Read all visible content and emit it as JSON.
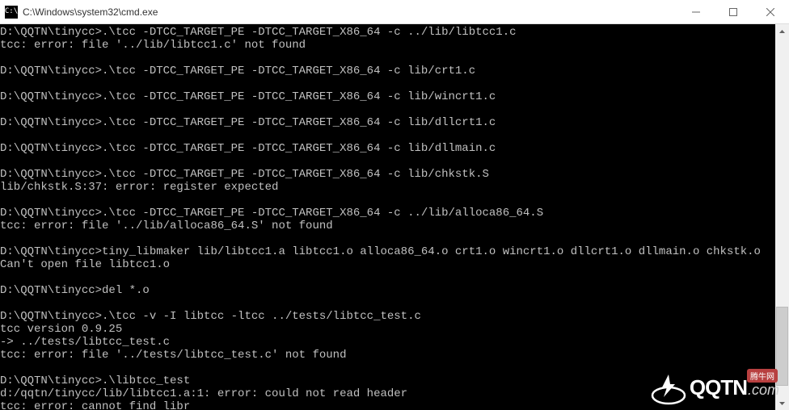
{
  "window": {
    "title": "C:\\Windows\\system32\\cmd.exe"
  },
  "terminal": {
    "lines": [
      "D:\\QQTN\\tinycc>.\\tcc -DTCC_TARGET_PE -DTCC_TARGET_X86_64 -c ../lib/libtcc1.c",
      "tcc: error: file '../lib/libtcc1.c' not found",
      "",
      "D:\\QQTN\\tinycc>.\\tcc -DTCC_TARGET_PE -DTCC_TARGET_X86_64 -c lib/crt1.c",
      "",
      "D:\\QQTN\\tinycc>.\\tcc -DTCC_TARGET_PE -DTCC_TARGET_X86_64 -c lib/wincrt1.c",
      "",
      "D:\\QQTN\\tinycc>.\\tcc -DTCC_TARGET_PE -DTCC_TARGET_X86_64 -c lib/dllcrt1.c",
      "",
      "D:\\QQTN\\tinycc>.\\tcc -DTCC_TARGET_PE -DTCC_TARGET_X86_64 -c lib/dllmain.c",
      "",
      "D:\\QQTN\\tinycc>.\\tcc -DTCC_TARGET_PE -DTCC_TARGET_X86_64 -c lib/chkstk.S",
      "lib/chkstk.S:37: error: register expected",
      "",
      "D:\\QQTN\\tinycc>.\\tcc -DTCC_TARGET_PE -DTCC_TARGET_X86_64 -c ../lib/alloca86_64.S",
      "tcc: error: file '../lib/alloca86_64.S' not found",
      "",
      "D:\\QQTN\\tinycc>tiny_libmaker lib/libtcc1.a libtcc1.o alloca86_64.o crt1.o wincrt1.o dllcrt1.o dllmain.o chkstk.o",
      "Can't open file libtcc1.o",
      "",
      "D:\\QQTN\\tinycc>del *.o",
      "",
      "D:\\QQTN\\tinycc>.\\tcc -v -I libtcc -ltcc ../tests/libtcc_test.c",
      "tcc version 0.9.25",
      "-> ../tests/libtcc_test.c",
      "tcc: error: file '../tests/libtcc_test.c' not found",
      "",
      "D:\\QQTN\\tinycc>.\\libtcc_test",
      "d:/qqtn/tinycc/lib/libtcc1.a:1: error: could not read header",
      "tcc: error: cannot find libr"
    ]
  },
  "watermark": {
    "brand": "QQTN",
    "suffix": ".com",
    "badge": "腾牛网"
  }
}
